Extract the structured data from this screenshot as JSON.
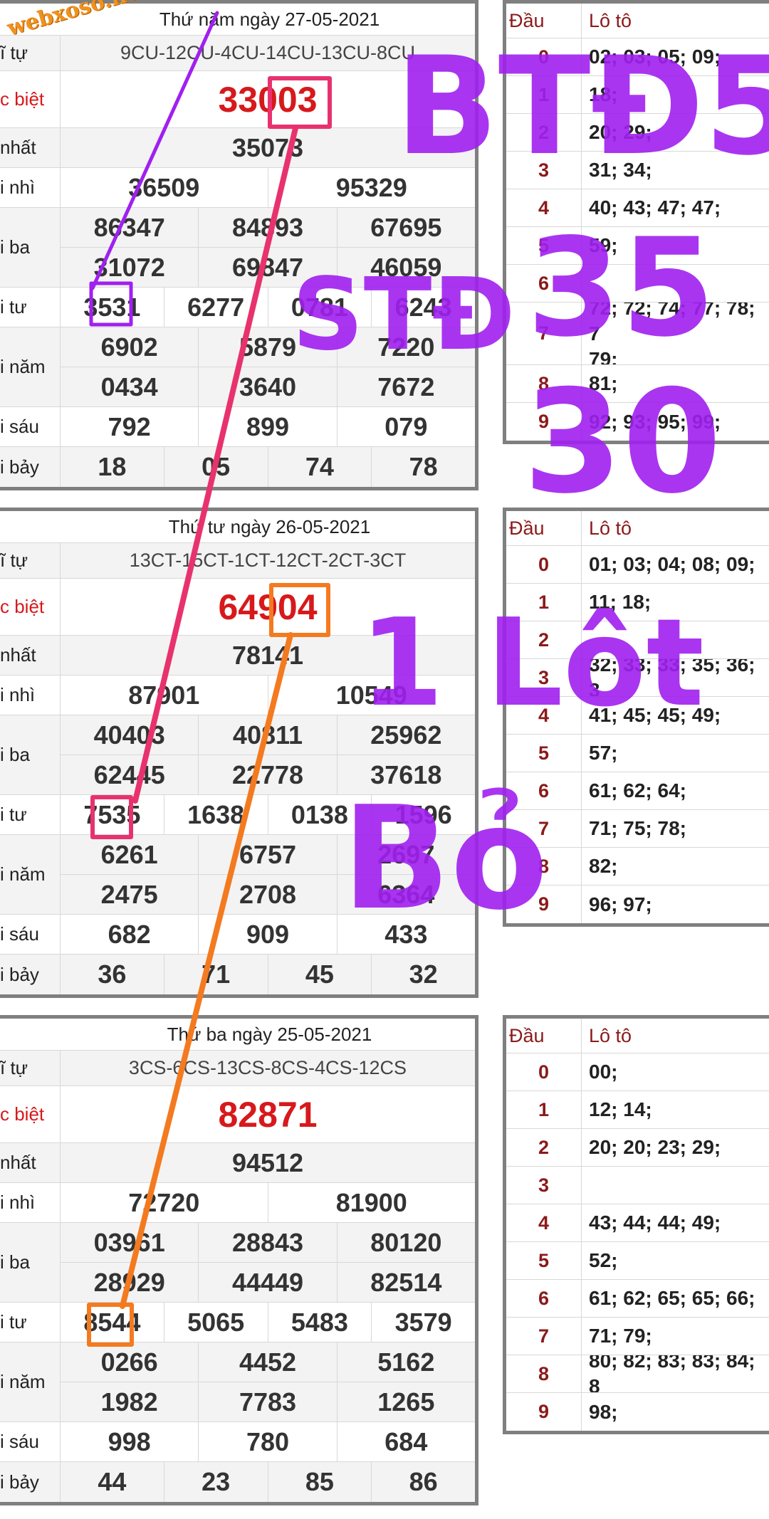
{
  "watermark": "webxoso.net",
  "labels": [
    "ĩ tự",
    "c biệt",
    "nhất",
    "i nhì",
    "i ba",
    "i tư",
    "i năm",
    "i sáu",
    "i bảy"
  ],
  "lo_headers": {
    "dau": "Đầu",
    "loto": "Lô tô"
  },
  "blocks": [
    {
      "date": "Thứ năm ngày 27-05-2021",
      "codes": "9CU-12CU-4CU-14CU-13CU-8CU",
      "special": "33003",
      "first": "35073",
      "second": [
        "36509",
        "95329"
      ],
      "third": [
        [
          "86347",
          "84893",
          "67695"
        ],
        [
          "31072",
          "69847",
          "46059"
        ]
      ],
      "fourth": [
        "3531",
        "6277",
        "0781",
        "6243"
      ],
      "fifth": [
        [
          "6902",
          "5879",
          "7220"
        ],
        [
          "0434",
          "3640",
          "7672"
        ]
      ],
      "sixth": [
        "792",
        "899",
        "079"
      ],
      "seventh": [
        "18",
        "05",
        "74",
        "78"
      ],
      "loto": [
        "02; 03; 05; 09;",
        "18;",
        "20; 29;",
        "31; 34;",
        "40; 43; 47; 47;",
        "59;",
        "",
        "72; 72; 74; 77; 78; 7\n79;",
        "81;",
        "92; 93; 95; 99;"
      ]
    },
    {
      "date": "Thứ tư ngày 26-05-2021",
      "codes": "13CT-15CT-1CT-12CT-2CT-3CT",
      "special": "64904",
      "first": "78141",
      "second": [
        "87901",
        "10549"
      ],
      "third": [
        [
          "40403",
          "40811",
          "25962"
        ],
        [
          "62445",
          "22778",
          "37618"
        ]
      ],
      "fourth": [
        "7535",
        "1638",
        "0138",
        "1596"
      ],
      "fifth": [
        [
          "6261",
          "6757",
          "2697"
        ],
        [
          "2475",
          "2708",
          "6364"
        ]
      ],
      "sixth": [
        "682",
        "909",
        "433"
      ],
      "seventh": [
        "36",
        "71",
        "45",
        "32"
      ],
      "loto": [
        "01; 03; 04; 08; 09;",
        "11; 18;",
        "",
        "32; 33; 33; 35; 36; 3",
        "41; 45; 45; 49;",
        "57;",
        "61; 62; 64;",
        "71; 75; 78;",
        "82;",
        "96; 97;"
      ]
    },
    {
      "date": "Thứ ba ngày 25-05-2021",
      "codes": "3CS-6CS-13CS-8CS-4CS-12CS",
      "special": "82871",
      "first": "94512",
      "second": [
        "72720",
        "81900"
      ],
      "third": [
        [
          "03961",
          "28843",
          "80120"
        ],
        [
          "28929",
          "44449",
          "82514"
        ]
      ],
      "fourth": [
        "8544",
        "5065",
        "5483",
        "3579"
      ],
      "fifth": [
        [
          "0266",
          "4452",
          "5162"
        ],
        [
          "1982",
          "7783",
          "1265"
        ]
      ],
      "sixth": [
        "998",
        "780",
        "684"
      ],
      "seventh": [
        "44",
        "23",
        "85",
        "86"
      ],
      "loto": [
        "00;",
        "12; 14;",
        "20; 20; 23; 29;",
        "",
        "43; 44; 44; 49;",
        "52;",
        "61; 62; 65; 65; 66;",
        "71; 79;",
        "80; 82; 83; 83; 84; 8",
        "98;"
      ]
    }
  ],
  "heads": [
    "0",
    "1",
    "2",
    "3",
    "4",
    "5",
    "6",
    "7",
    "8",
    "9"
  ],
  "annotations": [
    "BTĐ53",
    "35",
    "30",
    "STĐ",
    "1 Lôt",
    "Bỏ"
  ],
  "colors": {
    "special": "#d7191c",
    "border": "#7f7f7f",
    "head": "#8b1a1a",
    "ink": "#a020f0",
    "pink": "#e8326e",
    "orange": "#f47a20"
  }
}
